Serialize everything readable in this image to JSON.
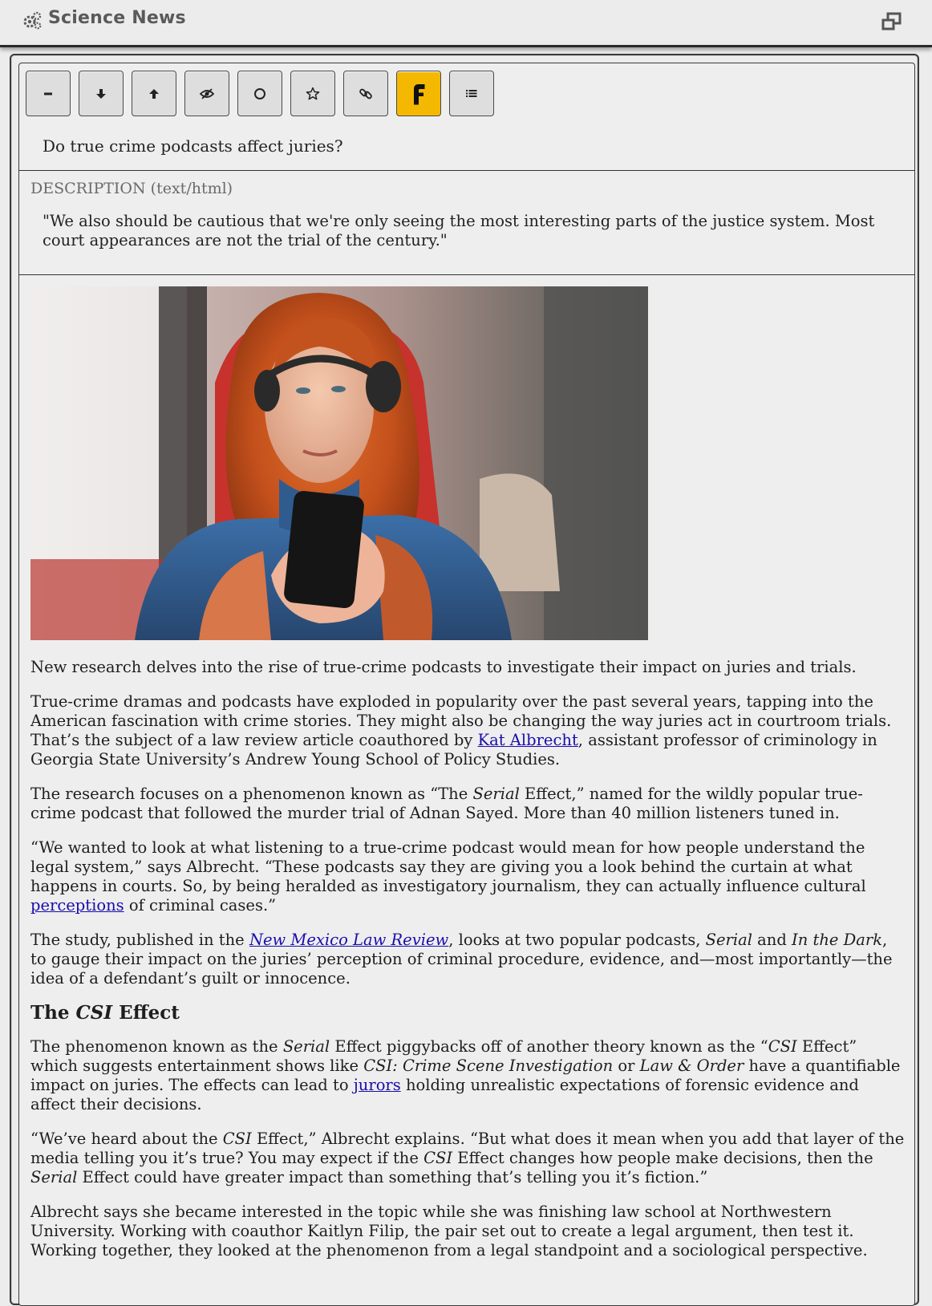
{
  "app": {
    "title": "Science News",
    "gear_icon": "gear-icon",
    "restore_icon": "window-restore-icon"
  },
  "toolbar": {
    "buttons": [
      {
        "name": "collapse-button",
        "icon": "minus-icon"
      },
      {
        "name": "next-button",
        "icon": "arrow-down-icon"
      },
      {
        "name": "previous-button",
        "icon": "arrow-up-icon"
      },
      {
        "name": "hide-button",
        "icon": "eye-slash-icon"
      },
      {
        "name": "mark-read-button",
        "icon": "circle-icon"
      },
      {
        "name": "star-button",
        "icon": "star-icon"
      },
      {
        "name": "link-button",
        "icon": "link-icon"
      },
      {
        "name": "feedly-button",
        "icon": "feedly-icon",
        "color": "#f5b800"
      },
      {
        "name": "list-button",
        "icon": "list-icon"
      }
    ]
  },
  "item": {
    "title": "Do true crime podcasts affect juries?"
  },
  "description": {
    "label": "DESCRIPTION (text/html)",
    "text": "\"We also should be cautious that we're only seeing the most interesting parts of the justice system. Most court appearances are not the trial of the century.\""
  },
  "article": {
    "image_subject": "woman with red hair wearing headphones holding a phone on a train",
    "p1": "New research delves into the rise of true-crime podcasts to investigate their impact on juries and trials.",
    "p2": {
      "a": "True-crime dramas and podcasts have exploded in popularity over the past several years, tapping into the American fascination with crime stories. They might also be changing the way juries act in courtroom trials. That’s the subject of a law review article coauthored by ",
      "link": "Kat Albrecht",
      "b": ", assistant professor of criminology in Georgia State University’s Andrew Young School of Policy Studies."
    },
    "p3": {
      "a": "The research focuses on a phenomenon known as “The ",
      "em": "Serial",
      "b": " Effect,” named for the wildly popular true-crime podcast that followed the murder trial of Adnan Sayed. More than 40 million listeners tuned in."
    },
    "p4": {
      "a": "“We wanted to look at what listening to a true-crime podcast would mean for how people understand the legal system,” says Albrecht. “These podcasts say they are giving you a look behind the curtain at what happens in courts. So, by being heralded as investigatory journalism, they can actually influence cultural ",
      "link": "perceptions",
      "b": " of criminal cases.”"
    },
    "p5": {
      "a": "The study, published in the ",
      "link": "New Mexico Law Review",
      "b": ", looks at two popular podcasts, ",
      "em1": "Serial",
      "c": " and ",
      "em2": "In the Dark",
      "d": ", to gauge their impact on the juries’ perception of criminal procedure, evidence, and—most importantly—the idea of a defendant’s guilt or innocence."
    },
    "h1": {
      "a": "The ",
      "em": "CSI",
      "b": " Effect"
    },
    "p6": {
      "a": "The phenomenon known as the ",
      "em1": "Serial",
      "b": " Effect piggybacks off of another theory known as the “",
      "em2": "CSI",
      "c": " Effect” which suggests entertainment shows like ",
      "em3": "CSI: Crime Scene Investigation",
      "d": " or ",
      "em4": "Law & Order",
      "e": " have a quantifiable impact on juries. The effects can lead to ",
      "link": "jurors",
      "f": " holding unrealistic expectations of forensic evidence and affect their decisions."
    },
    "p7": {
      "a": "“We’ve heard about the ",
      "em1": "CSI",
      "b": " Effect,” Albrecht explains. “But what does it mean when you add that layer of the media telling you it’s true? You may expect if the ",
      "em2": "CSI",
      "c": " Effect changes how people make decisions, then the ",
      "em3": "Serial",
      "d": " Effect could have greater impact than something that’s telling you it’s fiction.”"
    },
    "p8": "Albrecht says she became interested in the topic while she was finishing law school at Northwestern University. Working with coauthor Kaitlyn Filip, the pair set out to create a legal argument, then test it. Working together, they looked at the phenomenon from a legal standpoint and a sociological perspective."
  }
}
